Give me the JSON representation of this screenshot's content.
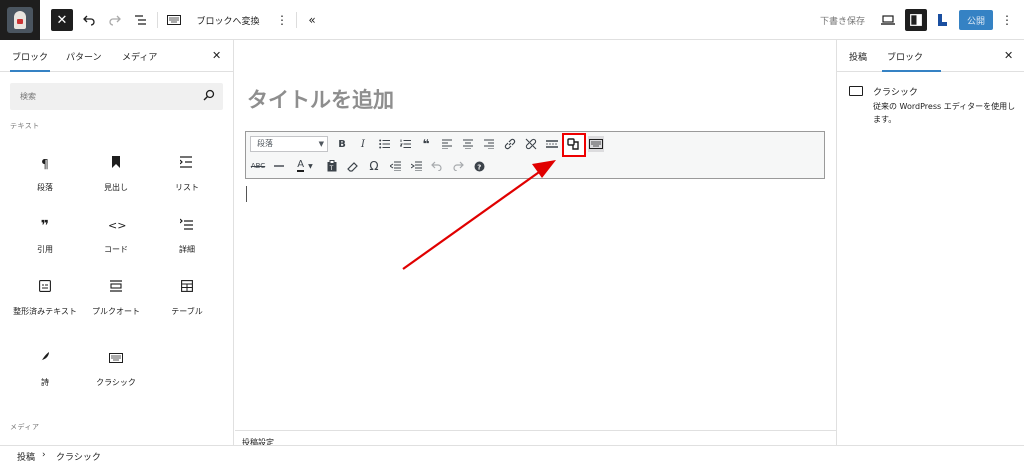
{
  "topbar": {
    "convert_label": "ブロックへ変換",
    "save_draft": "下書き保存",
    "publish": "公開"
  },
  "left_panel": {
    "tabs": [
      "ブロック",
      "パターン",
      "メディア"
    ],
    "search_placeholder": "検索",
    "categories": {
      "text": "テキスト",
      "media": "メディア"
    },
    "blocks": [
      {
        "label": "段落",
        "icon": "paragraph-icon"
      },
      {
        "label": "見出し",
        "icon": "bookmark-icon"
      },
      {
        "label": "リスト",
        "icon": "list-icon"
      },
      {
        "label": "引用",
        "icon": "quote-icon"
      },
      {
        "label": "コード",
        "icon": "code-icon"
      },
      {
        "label": "詳細",
        "icon": "details-icon"
      },
      {
        "label": "整形済みテキスト",
        "icon": "preformatted-icon"
      },
      {
        "label": "プルクオート",
        "icon": "pullquote-icon"
      },
      {
        "label": "テーブル",
        "icon": "table-icon"
      },
      {
        "label": "詩",
        "icon": "verse-icon"
      },
      {
        "label": "クラシック",
        "icon": "keyboard-icon"
      }
    ]
  },
  "editor": {
    "title_placeholder": "タイトルを追加",
    "format_select": "段落",
    "post_settings": "投稿設定"
  },
  "right_panel": {
    "tabs": [
      "投稿",
      "ブロック"
    ],
    "block_name": "クラシック",
    "block_desc": "従来の WordPress エディターを使用します。"
  },
  "footer": {
    "crumbs": [
      "投稿",
      "クラシック"
    ]
  },
  "colors": {
    "accent": "#3582c4",
    "highlight": "#e00000"
  }
}
